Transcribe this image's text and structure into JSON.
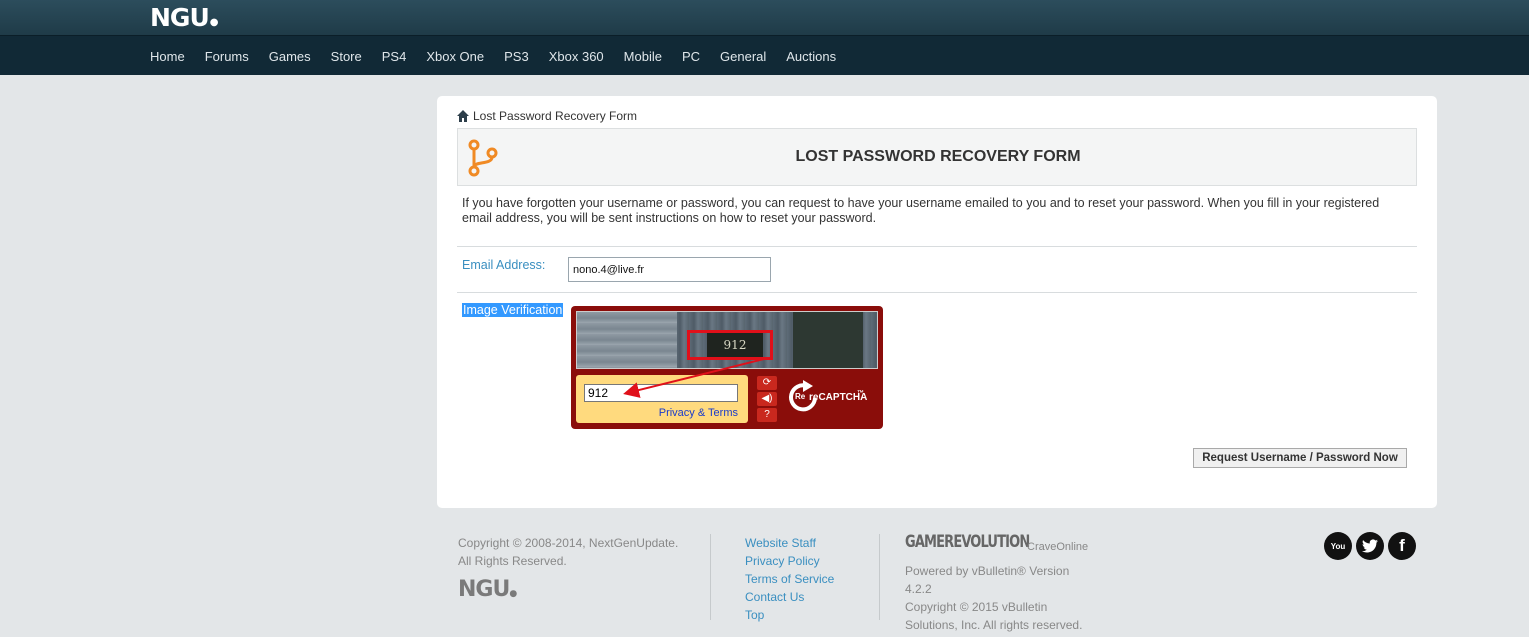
{
  "site": {
    "logo_text": "NGU"
  },
  "nav": {
    "items": [
      "Home",
      "Forums",
      "Games",
      "Store",
      "PS4",
      "Xbox One",
      "PS3",
      "Xbox 360",
      "Mobile",
      "PC",
      "General",
      "Auctions"
    ]
  },
  "breadcrumb": {
    "label": "Lost Password Recovery Form",
    "icon": "home-icon"
  },
  "form": {
    "title": "LOST PASSWORD RECOVERY FORM",
    "icon": "branch-icon",
    "description": "If you have forgotten your username or password, you can request to have your username emailed to you and to reset your password. When you fill in your registered email address, you will be sent instructions on how to reset your password.",
    "email_label": "Email Address:",
    "email_value": "nono.4@live.fr",
    "image_verification_label": "Image Verification",
    "submit_label": "Request Username / Password Now"
  },
  "recaptcha": {
    "image_text": "912",
    "input_value": "912",
    "privacy_terms": "Privacy & Terms",
    "buttons": [
      "refresh-icon",
      "audio-icon",
      "help-icon"
    ],
    "logo_text": "reCAPTCHA",
    "logo_prefix": "Re",
    "logo_tm": "™",
    "highlight_color": "#e0101a"
  },
  "footer": {
    "copyright_line1": "Copyright © 2008-2014, NextGenUpdate.",
    "copyright_line2": "All Rights Reserved.",
    "logo_text": "NGU",
    "links": [
      "Website Staff",
      "Privacy Policy",
      "Terms of Service",
      "Contact Us",
      "Top"
    ],
    "gamerevolution": "GAMEREVOLUTION",
    "craveonline": "CraveOnline",
    "powered_line1": "Powered by vBulletin® Version",
    "powered_line2": "4.2.2",
    "powered_line3": "Copyright © 2015 vBulletin",
    "powered_line4": "Solutions, Inc. All rights reserved.",
    "social": [
      "youtube-icon",
      "twitter-icon",
      "facebook-icon"
    ]
  },
  "colors": {
    "accent_blue": "#3a8fc0",
    "recaptcha_red": "#8a0d0a",
    "form_icon_orange": "#f08a24"
  }
}
